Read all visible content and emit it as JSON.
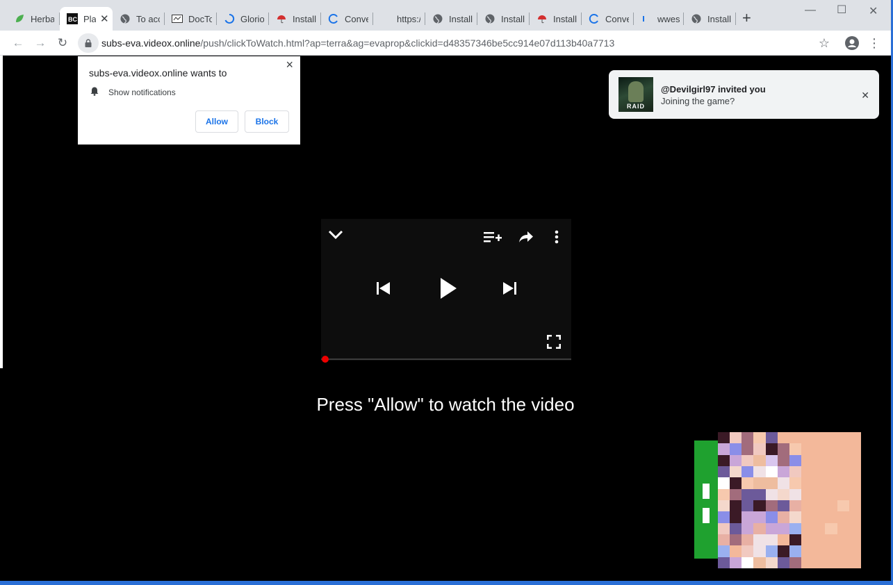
{
  "tabs": [
    {
      "label": "Herba",
      "icon": "leaf-icon"
    },
    {
      "label": "Pla",
      "icon": "bc-icon",
      "active": true
    },
    {
      "label": "To acc",
      "icon": "globe-icon"
    },
    {
      "label": "DocTo",
      "icon": "doc-icon"
    },
    {
      "label": "Glorio",
      "icon": "spinner-icon"
    },
    {
      "label": "Install",
      "icon": "umbrella-icon"
    },
    {
      "label": "Conve",
      "icon": "spinner-icon"
    },
    {
      "label": "https:/",
      "icon": "blank-icon"
    },
    {
      "label": "Install",
      "icon": "globe-icon"
    },
    {
      "label": "Install",
      "icon": "globe-icon"
    },
    {
      "label": "Install",
      "icon": "umbrella-icon"
    },
    {
      "label": "Conve",
      "icon": "spinner-icon"
    },
    {
      "label": "wwes",
      "icon": "spinner-icon"
    },
    {
      "label": "Install",
      "icon": "globe-icon"
    }
  ],
  "omnibox": {
    "host": "subs-eva.videox.online",
    "path": "/push/clickToWatch.html?ap=terra&ag=evaprop&clickid=d48357346be5cc914e07d113b40a7713"
  },
  "permission": {
    "title": "subs-eva.videox.online wants to",
    "item": "Show notifications",
    "allow": "Allow",
    "block": "Block"
  },
  "toast": {
    "line1": "@Devilgirl97 invited you",
    "line2": "Joining the game?",
    "thumb_text": "RAID"
  },
  "player": {
    "progress": 0
  },
  "prompt": "Press \"Allow\" to watch the video",
  "colors": {
    "accent": "#1a73e8",
    "progress_dot": "#ee0000",
    "ad_green": "#1fa12f",
    "window_border": "#2a6fd6"
  }
}
